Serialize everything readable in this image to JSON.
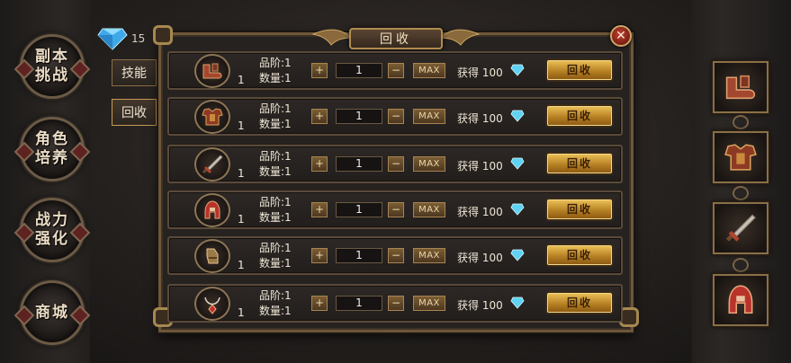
{
  "currency": {
    "value": "15",
    "icon": "diamond-icon",
    "color": "#5fd3f3"
  },
  "left_menu": [
    {
      "label": "副本挑战",
      "icon": "dungeon-icon"
    },
    {
      "label": "角色培养",
      "icon": "character-icon"
    },
    {
      "label": "战力强化",
      "icon": "enhance-icon"
    },
    {
      "label": "商城",
      "icon": "shop-icon"
    }
  ],
  "side_tabs": [
    {
      "label": "技能"
    },
    {
      "label": "回收"
    }
  ],
  "panel": {
    "title": "回收",
    "close_icon": "close-icon"
  },
  "rows": [
    {
      "icon": "boots-icon",
      "count": "1",
      "grade": "品阶:1",
      "qty": "数量:1",
      "input": "1",
      "plus": "+",
      "minus": "−",
      "max": "MAX",
      "gain": "获得 100",
      "recycle": "回收"
    },
    {
      "icon": "armor-icon",
      "count": "1",
      "grade": "品阶:1",
      "qty": "数量:1",
      "input": "1",
      "plus": "+",
      "minus": "−",
      "max": "MAX",
      "gain": "获得 100",
      "recycle": "回收"
    },
    {
      "icon": "sword-icon",
      "count": "1",
      "grade": "品阶:1",
      "qty": "数量:1",
      "input": "1",
      "plus": "+",
      "minus": "−",
      "max": "MAX",
      "gain": "获得 100",
      "recycle": "回收"
    },
    {
      "icon": "helmet-icon",
      "count": "1",
      "grade": "品阶:1",
      "qty": "数量:1",
      "input": "1",
      "plus": "+",
      "minus": "−",
      "max": "MAX",
      "gain": "获得 100",
      "recycle": "回收"
    },
    {
      "icon": "gloves-icon",
      "count": "1",
      "grade": "品阶:1",
      "qty": "数量:1",
      "input": "1",
      "plus": "+",
      "minus": "−",
      "max": "MAX",
      "gain": "获得 100",
      "recycle": "回收"
    },
    {
      "icon": "necklace-icon",
      "count": "1",
      "grade": "品阶:1",
      "qty": "数量:1",
      "input": "1",
      "plus": "+",
      "minus": "−",
      "max": "MAX",
      "gain": "获得 100",
      "recycle": "回收"
    }
  ],
  "equip_slots": [
    {
      "icon": "boots-icon"
    },
    {
      "icon": "armor-icon"
    },
    {
      "icon": "sword-icon"
    },
    {
      "icon": "helmet-icon"
    }
  ]
}
